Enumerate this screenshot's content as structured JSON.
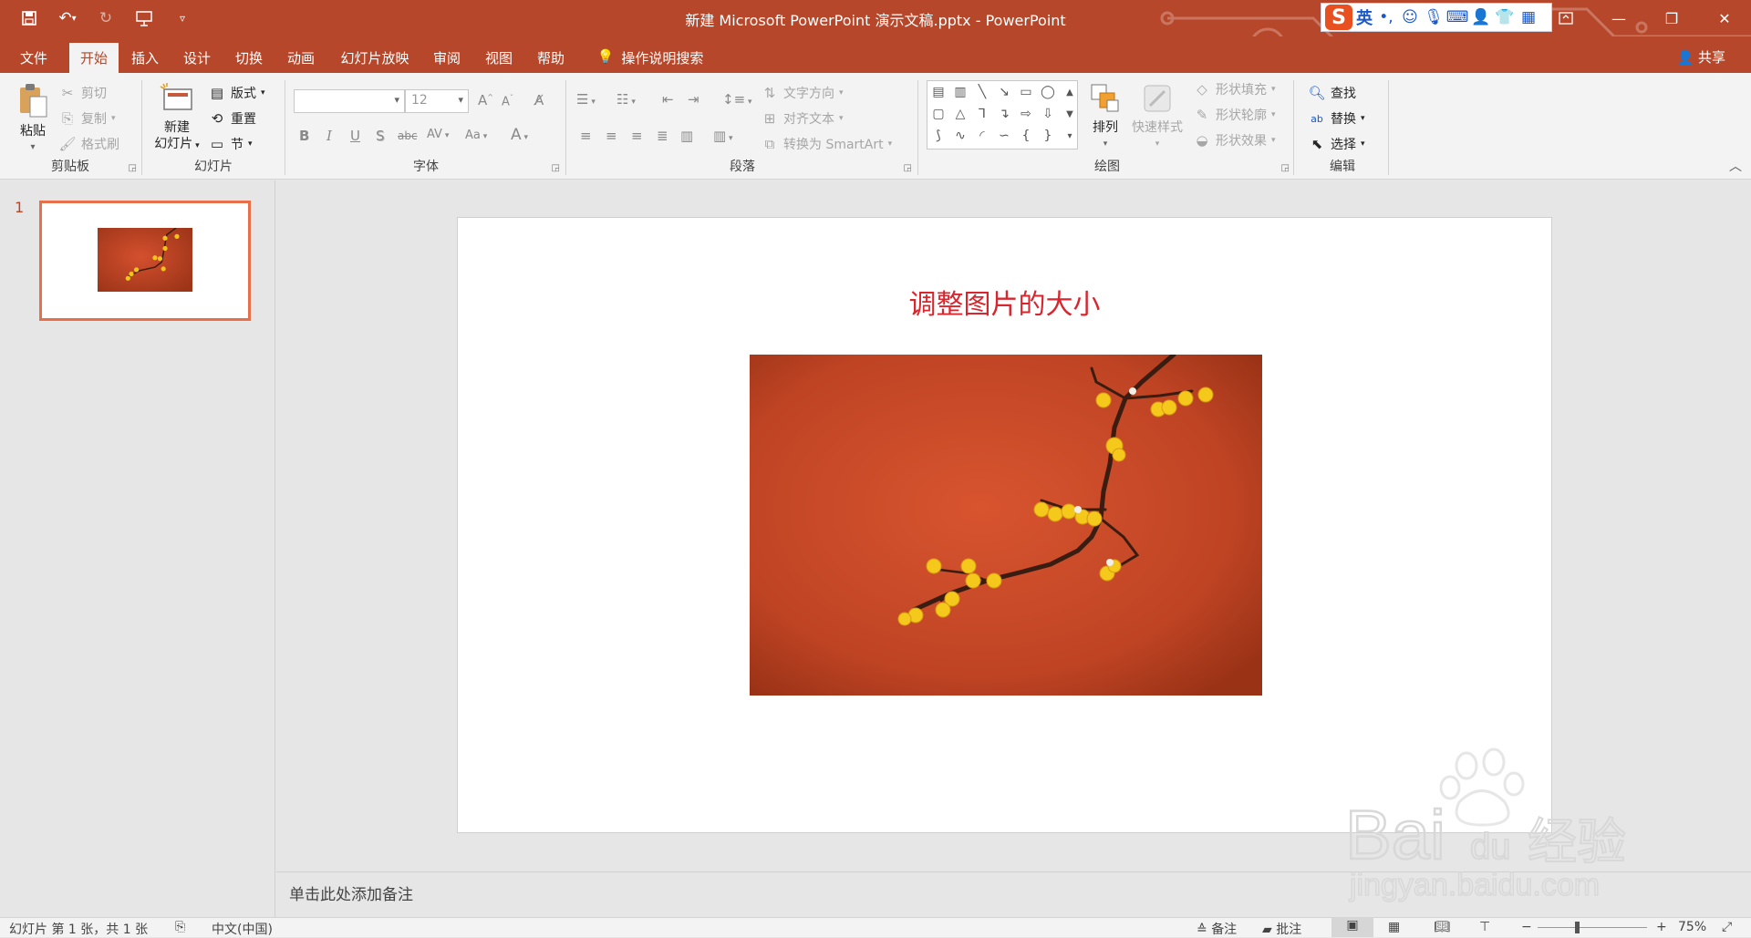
{
  "window": {
    "title": "新建 Microsoft PowerPoint 演示文稿.pptx  -  PowerPoint"
  },
  "ime": {
    "mode": "英",
    "punct": "•,"
  },
  "tabs": [
    {
      "label": "文件",
      "active": false
    },
    {
      "label": "开始",
      "active": true
    },
    {
      "label": "插入",
      "active": false
    },
    {
      "label": "设计",
      "active": false
    },
    {
      "label": "切换",
      "active": false
    },
    {
      "label": "动画",
      "active": false
    },
    {
      "label": "幻灯片放映",
      "active": false
    },
    {
      "label": "审阅",
      "active": false
    },
    {
      "label": "视图",
      "active": false
    },
    {
      "label": "帮助",
      "active": false
    },
    {
      "label": "操作说明搜索",
      "active": false
    }
  ],
  "share_label": "共享",
  "ribbon": {
    "clipboard": {
      "label": "剪贴板",
      "paste": "粘贴",
      "cut": "剪切",
      "copy": "复制",
      "format_painter": "格式刷"
    },
    "slides": {
      "label": "幻灯片",
      "new_slide_line1": "新建",
      "new_slide_line2": "幻灯片",
      "layout": "版式",
      "reset": "重置",
      "section": "节"
    },
    "font": {
      "label": "字体",
      "font_name": "",
      "font_size": "12",
      "bold": "B",
      "italic": "I",
      "underline": "U",
      "shadow": "S",
      "strike": "abc",
      "spacing": "AV",
      "case": "Aa",
      "grow": "A",
      "shrink": "A",
      "color": "A"
    },
    "paragraph": {
      "label": "段落",
      "text_direction": "文字方向",
      "align_text": "对齐文本",
      "smartart": "转换为 SmartArt"
    },
    "drawing": {
      "label": "绘图",
      "arrange": "排列",
      "quick_styles": "快速样式",
      "shape_fill": "形状填充",
      "shape_outline": "形状轮廓",
      "shape_effects": "形状效果"
    },
    "editing": {
      "label": "编辑",
      "find": "查找",
      "replace": "替换",
      "select": "选择"
    }
  },
  "thumbnails": [
    {
      "number": "1"
    }
  ],
  "slide": {
    "title": "调整图片的大小"
  },
  "notes": {
    "placeholder": "单击此处添加备注"
  },
  "status": {
    "slide_info": "幻灯片 第 1 张，共 1 张",
    "language": "中文(中国)",
    "notes": "备注",
    "comments": "批注",
    "zoom": "75%",
    "zoom_level": 0.75
  },
  "watermark": {
    "brand": "Bai",
    "brand2": "du",
    "cn": "经验",
    "url": "jingyan.baidu.com"
  },
  "colors": {
    "accent": "#b7472a",
    "title_red": "#d9262e",
    "thumb_border": "#e5704a"
  }
}
